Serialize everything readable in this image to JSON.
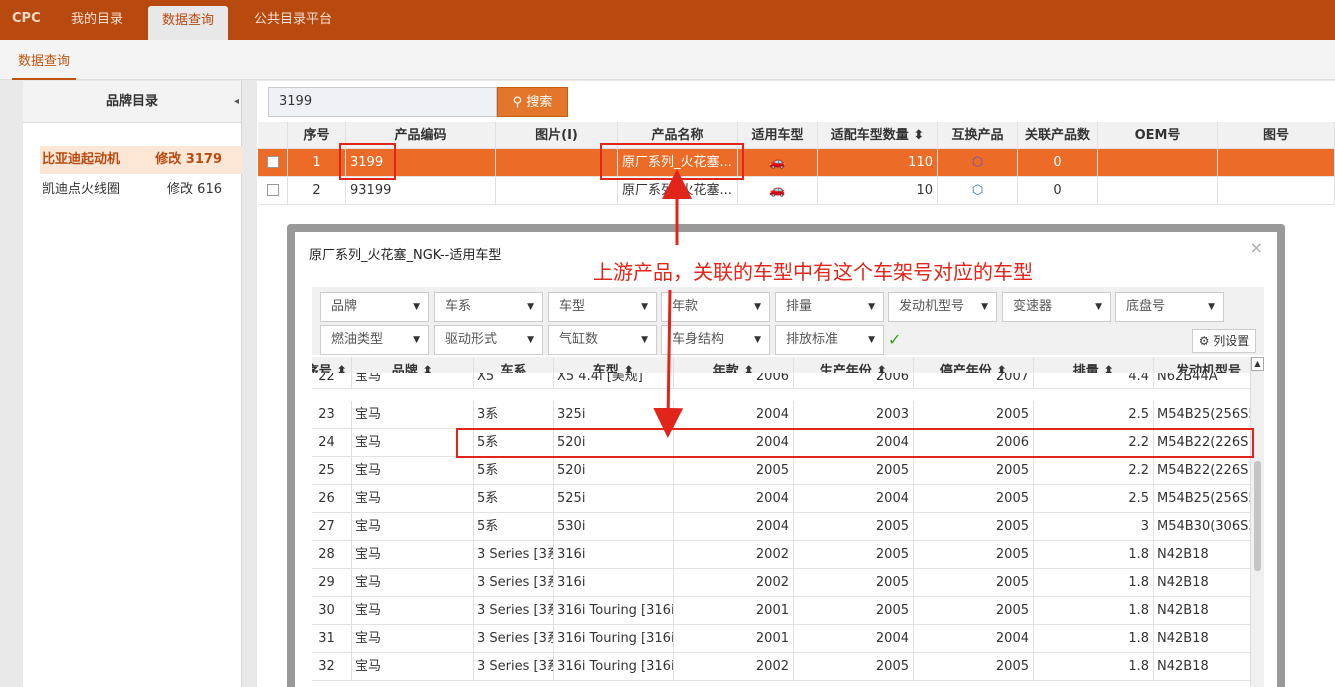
{
  "topnav": {
    "brand": "CPC",
    "items": [
      "我的目录",
      "数据查询",
      "公共目录平台"
    ]
  },
  "subnav": {
    "tab": "数据查询"
  },
  "left": {
    "title": "品牌目录",
    "collapse": "◂",
    "brands": [
      {
        "name": "比亚迪起动机",
        "count": "修改 3179"
      },
      {
        "name": "凯迪点火线圈",
        "count": "修改 616"
      }
    ]
  },
  "search": {
    "value": "3199",
    "button": "搜索"
  },
  "product_table": {
    "headers": [
      "序号",
      "产品编码",
      "图片(I)",
      "产品名称",
      "适用车型",
      "适配车型数量",
      "互换产品",
      "关联产品数",
      "OEM号",
      "图号"
    ],
    "rows": [
      {
        "idx": "1",
        "code": "3199",
        "name": "原厂系列_火花塞...",
        "count": "110",
        "rel": "0"
      },
      {
        "idx": "2",
        "code": "93199",
        "name": "原厂系列_火花塞...",
        "count": "10",
        "rel": "0"
      }
    ]
  },
  "modal": {
    "title": "原厂系列_火花塞_NGK--适用车型",
    "close": "×",
    "col_settings": "列设置"
  },
  "annotation": "上游产品，关联的车型中有这个车架号对应的车型",
  "filters": [
    "品牌",
    "车系",
    "车型",
    "年款",
    "排量",
    "发动机型号",
    "变速器",
    "底盘号",
    "燃油类型",
    "驱动形式",
    "气缸数",
    "车身结构",
    "排放标准"
  ],
  "grid": {
    "headers": [
      "序号 ⬍",
      "品牌 ⬍",
      "车系",
      "车型 ⬍",
      "年款 ⬍",
      "生产年份 ⬍",
      "停产年份 ⬍",
      "排量 ⬍",
      "发动机型号"
    ],
    "rows": [
      [
        "22",
        "宝马",
        "X5",
        "X5 4.4i [美规]",
        "2006",
        "2006",
        "2007",
        "4.4",
        "N62B44A"
      ],
      [
        "23",
        "宝马",
        "3系",
        "325i",
        "2004",
        "2003",
        "2005",
        "2.5",
        "M54B25(256S5)"
      ],
      [
        "24",
        "宝马",
        "5系",
        "520i",
        "2004",
        "2004",
        "2006",
        "2.2",
        "M54B22(226S1)"
      ],
      [
        "25",
        "宝马",
        "5系",
        "520i",
        "2005",
        "2005",
        "2005",
        "2.2",
        "M54B22(226S1)"
      ],
      [
        "26",
        "宝马",
        "5系",
        "525i",
        "2004",
        "2004",
        "2005",
        "2.5",
        "M54B25(256S5)"
      ],
      [
        "27",
        "宝马",
        "5系",
        "530i",
        "2004",
        "2005",
        "2005",
        "3",
        "M54B30(306S3)"
      ],
      [
        "28",
        "宝马",
        "3 Series [3系]",
        "316i",
        "2002",
        "2005",
        "2005",
        "1.8",
        "N42B18"
      ],
      [
        "29",
        "宝马",
        "3 Series [3系]",
        "316i",
        "2002",
        "2005",
        "2005",
        "1.8",
        "N42B18"
      ],
      [
        "30",
        "宝马",
        "3 Series [3系]",
        "316i Touring [316i 旅行]",
        "2001",
        "2005",
        "2005",
        "1.8",
        "N42B18"
      ],
      [
        "31",
        "宝马",
        "3 Series [3系]",
        "316i Touring [316i 旅行]",
        "2001",
        "2004",
        "2004",
        "1.8",
        "N42B18"
      ],
      [
        "32",
        "宝马",
        "3 Series [3系]",
        "316i Touring [316i 旅行]",
        "2002",
        "2005",
        "2005",
        "1.8",
        "N42B18"
      ]
    ]
  }
}
